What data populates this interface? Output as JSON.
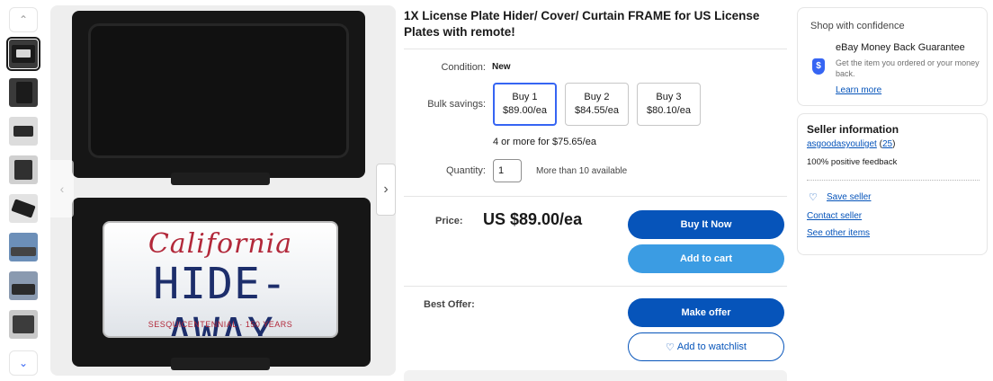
{
  "gallery": {
    "prev_icon": "chevron-up-icon",
    "next_icon": "chevron-down-icon",
    "thumbnail_count": 9,
    "selected_index": 0
  },
  "main_image": {
    "plate_state": "California",
    "plate_number": "HIDE-AWAY",
    "plate_bottom": "SESQUICENTENNIAL · 150 YEARS"
  },
  "listing": {
    "title": "1X License Plate Hider/ Cover/ Curtain FRAME for US License Plates with remote!",
    "condition_label": "Condition:",
    "condition_value": "New",
    "bulk_label": "Bulk savings:",
    "bulk_options": [
      {
        "qty": "Buy 1",
        "price": "$89.00/ea"
      },
      {
        "qty": "Buy 2",
        "price": "$84.55/ea"
      },
      {
        "qty": "Buy 3",
        "price": "$80.10/ea"
      }
    ],
    "bulk_more": "4 or more for $75.65/ea",
    "quantity_label": "Quantity:",
    "quantity_value": "1",
    "availability": "More than 10 available",
    "price_label": "Price:",
    "price": "US $89.00/ea",
    "buy_now": "Buy It Now",
    "add_to_cart": "Add to cart",
    "best_offer_label": "Best Offer:",
    "make_offer": "Make offer",
    "watchlist": "Add to watchlist"
  },
  "confidence": {
    "title": "Shop with confidence",
    "guarantee_title": "eBay Money Back Guarantee",
    "guarantee_desc": "Get the item you ordered or your money back.",
    "learn_more": "Learn more"
  },
  "seller": {
    "title": "Seller information",
    "name": "asgoodasyouliget",
    "feedback_count": "25",
    "feedback_percent": "100% positive feedback",
    "save_seller": "Save seller",
    "contact_seller": "Contact seller",
    "other_items": "See other items"
  },
  "colors": {
    "primary_button": "#0654ba",
    "secondary_button": "#3b9ce3",
    "link": "#0654ba",
    "selected_border": "#3665f3"
  }
}
